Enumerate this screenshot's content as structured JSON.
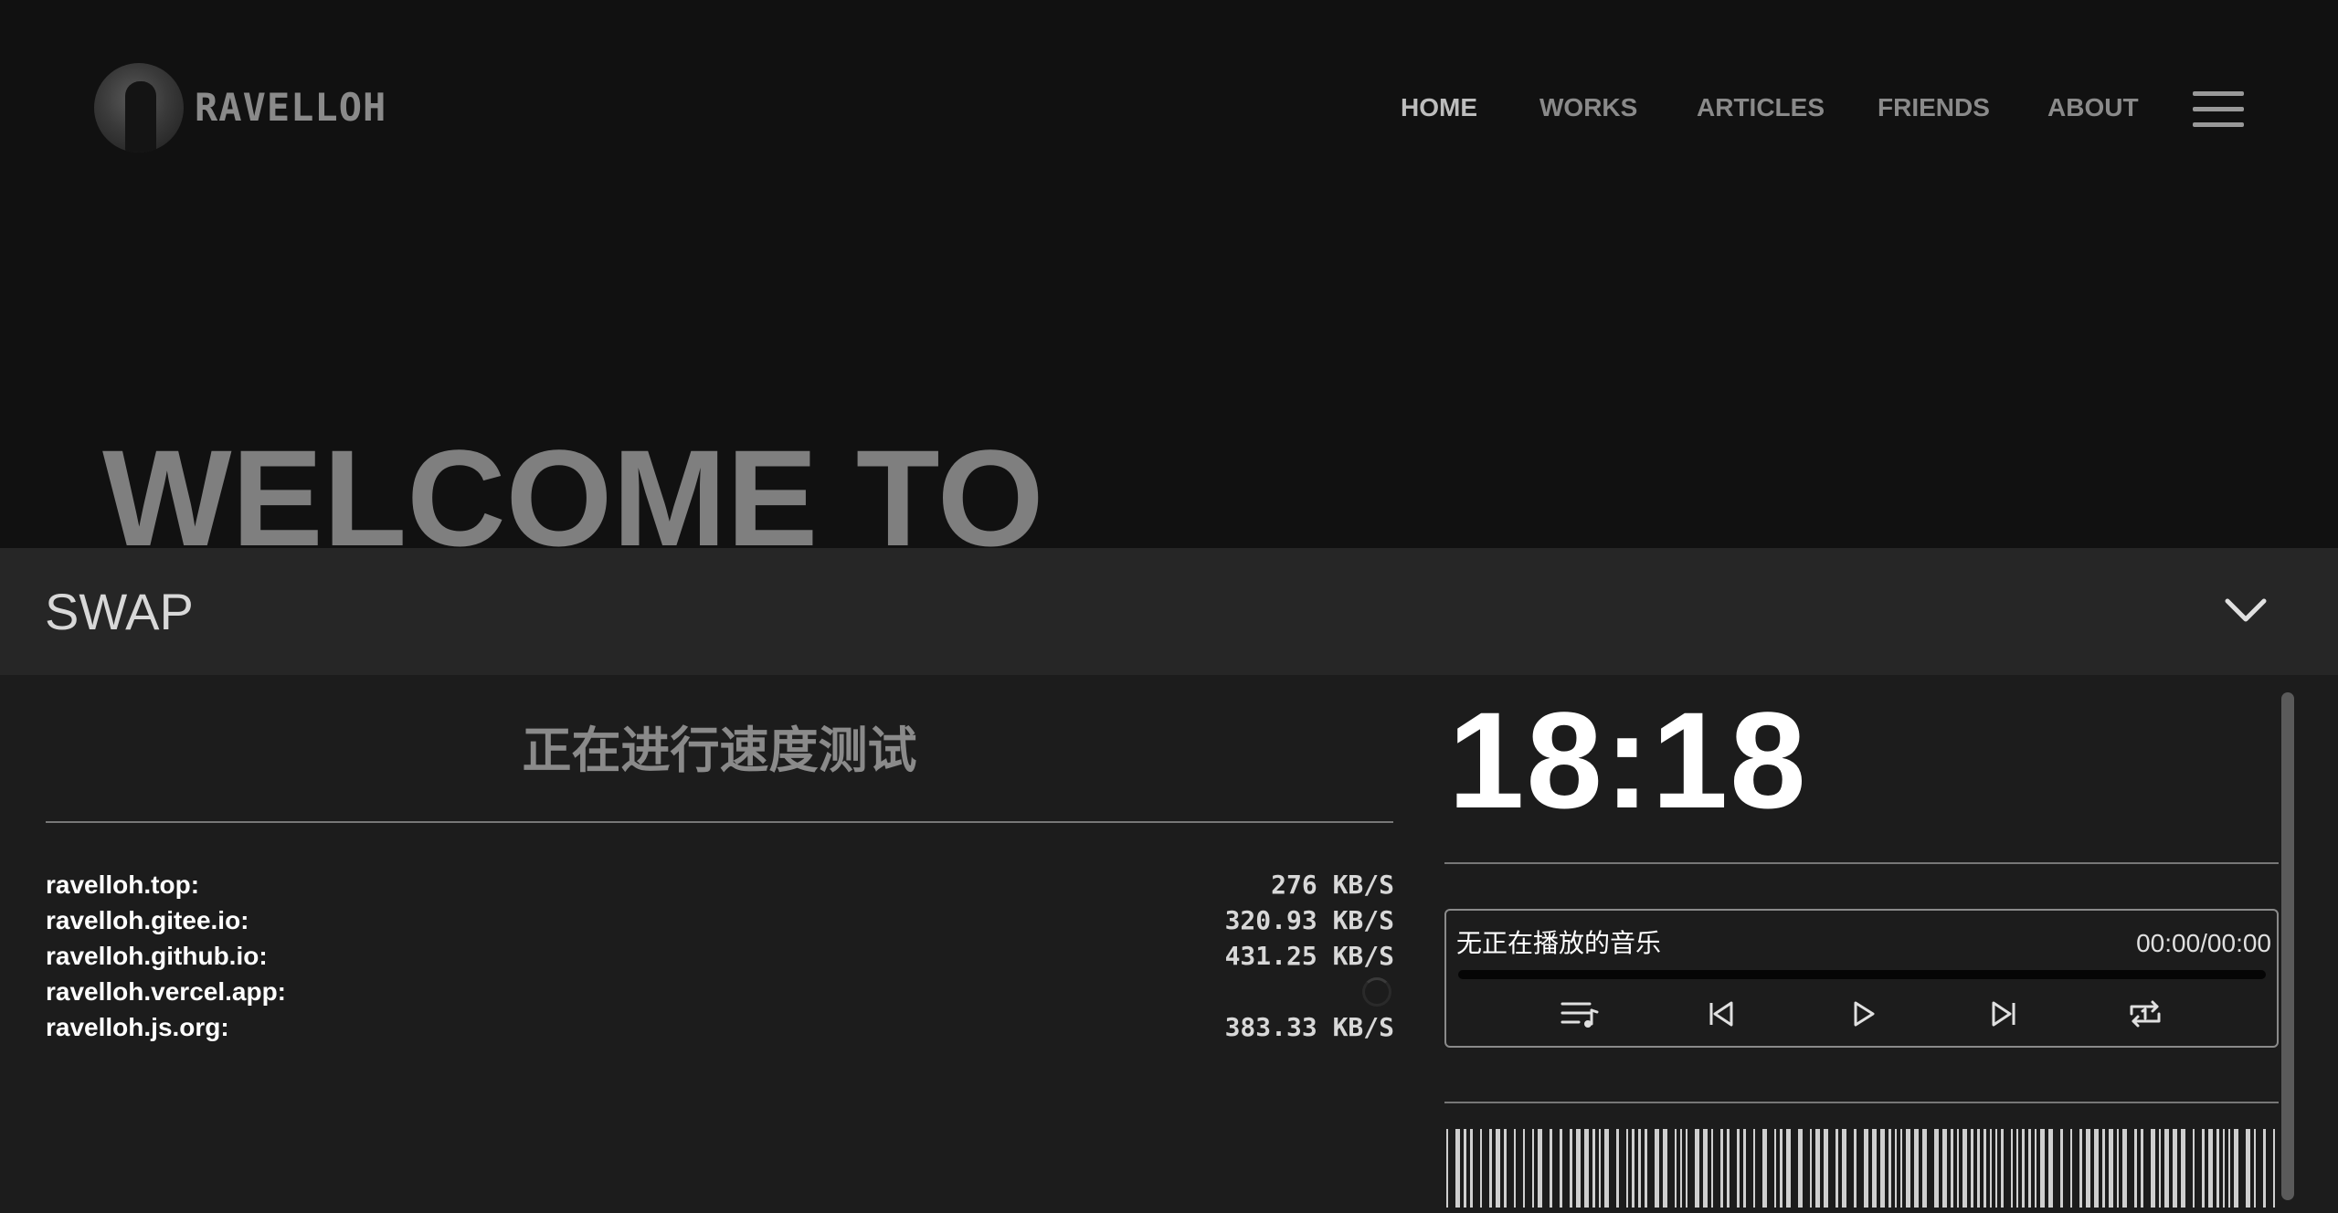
{
  "header": {
    "logo_text": "RAVELLOH",
    "nav": [
      "HOME",
      "WORKS",
      "ARTICLES",
      "FRIENDS",
      "ABOUT"
    ]
  },
  "hero": {
    "title": "WELCOME TO"
  },
  "swap": {
    "title": "SWAP",
    "speed_test": {
      "title": "正在进行速度测试",
      "rows": [
        {
          "site": "ravelloh.top:",
          "speed": "276 KB/S"
        },
        {
          "site": "ravelloh.gitee.io:",
          "speed": "320.93 KB/S"
        },
        {
          "site": "ravelloh.github.io:",
          "speed": "431.25 KB/S"
        },
        {
          "site": "ravelloh.vercel.app:",
          "speed": ""
        },
        {
          "site": "ravelloh.js.org:",
          "speed": "383.33 KB/S"
        }
      ]
    },
    "clock": "18:18",
    "player": {
      "song": "无正在播放的音乐",
      "time": "00:00/00:00",
      "icons": [
        "playlist-icon",
        "previous-icon",
        "play-icon",
        "next-icon",
        "repeat-one-icon"
      ]
    }
  },
  "colors": {
    "background": "#111111",
    "panel": "#1c1c1c",
    "bar": "#262626",
    "nav_text": "#8a8a8a"
  }
}
